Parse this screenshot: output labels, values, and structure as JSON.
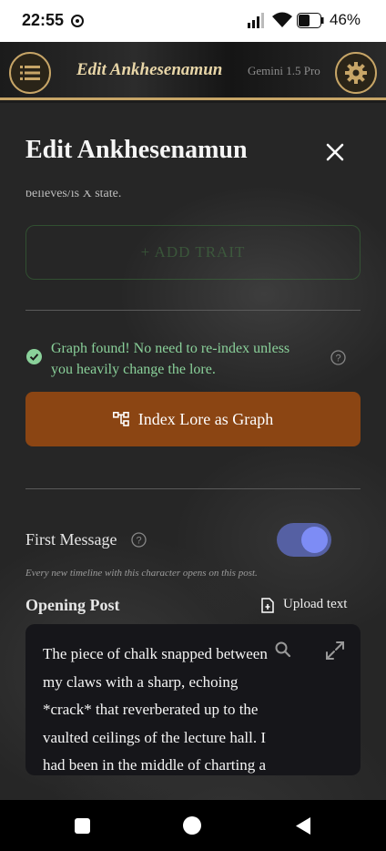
{
  "status_bar": {
    "time": "22:55",
    "battery": "46%"
  },
  "header": {
    "title": "Edit Ankhesenamun",
    "model": "Gemini 1.5 Pro"
  },
  "modal": {
    "title": "Edit Ankhesenamun",
    "cut_text": "believes/is X state.",
    "add_trait_label": "+ ADD TRAIT",
    "graph_status": "Graph found! No need to re-index unless you heavily change the lore.",
    "index_button_label": "Index Lore as Graph",
    "first_message": {
      "label": "First Message",
      "enabled": true,
      "hint": "Every new timeline with this character opens on this post."
    },
    "opening_post": {
      "label": "Opening Post",
      "upload_label": "Upload text",
      "text": "The piece of chalk snapped between my claws with a sharp, echoing *crack* that reverberated up to the vaulted ceilings of the lecture hall. I had been in the middle of charting a"
    }
  },
  "colors": {
    "accent_gold": "#c7a567",
    "graph_ok": "#8ad19a",
    "index_button": "#8b4513",
    "toggle_on": "#7d8cf5"
  }
}
